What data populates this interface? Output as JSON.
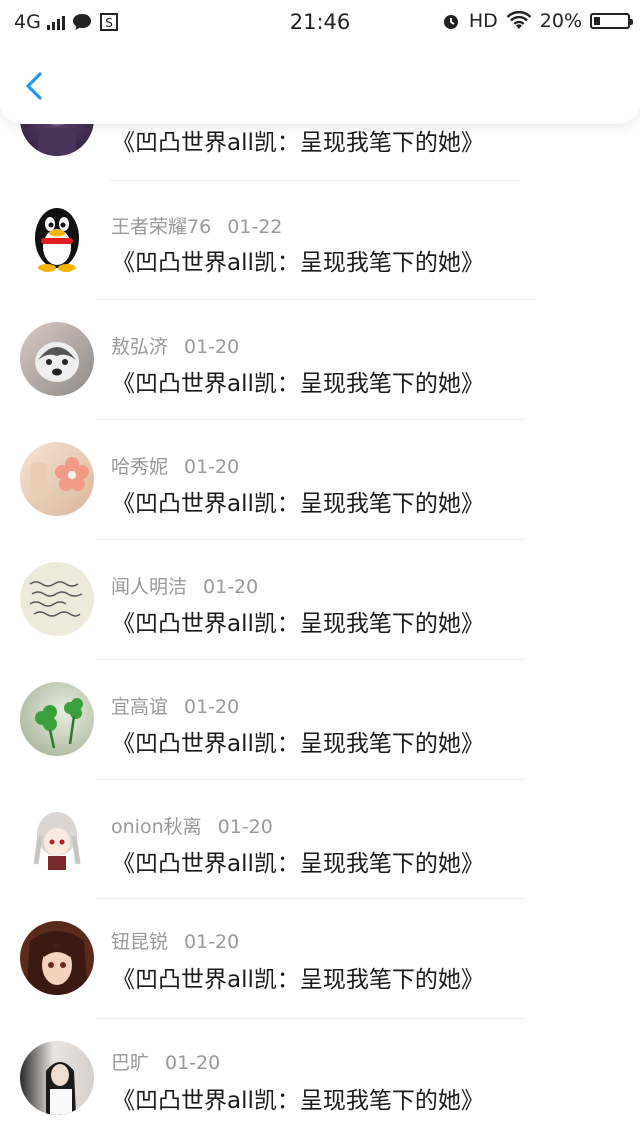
{
  "status_bar": {
    "network": "4G",
    "time": "21:46",
    "hd": "HD",
    "battery": "20%",
    "battery_level": 0.2
  },
  "header": {
    "back_icon": "chevron-left-icon",
    "accent_color": "#2196f3"
  },
  "items": [
    {
      "user": "",
      "date": "",
      "title": "《凹凸世界all凯：呈现我笔下的她》",
      "avatar": "dark-purple"
    },
    {
      "user": "王者荣耀76",
      "date": "01-22",
      "title": "《凹凸世界all凯：呈现我笔下的她》",
      "avatar": "penguin"
    },
    {
      "user": "敖弘济",
      "date": "01-20",
      "title": "《凹凸世界all凯：呈现我笔下的她》",
      "avatar": "husky"
    },
    {
      "user": "哈秀妮",
      "date": "01-20",
      "title": "《凹凸世界all凯：呈现我笔下的她》",
      "avatar": "flower"
    },
    {
      "user": "闻人明洁",
      "date": "01-20",
      "title": "《凹凸世界all凯：呈现我笔下的她》",
      "avatar": "handwriting"
    },
    {
      "user": "宜高谊",
      "date": "01-20",
      "title": "《凹凸世界all凯：呈现我笔下的她》",
      "avatar": "clover"
    },
    {
      "user": "onion秋离",
      "date": "01-20",
      "title": "《凹凸世界all凯：呈现我笔下的她》",
      "avatar": "anime-girl"
    },
    {
      "user": "钮昆锐",
      "date": "01-20",
      "title": "《凹凸世界all凯：呈现我笔下的她》",
      "avatar": "anime-dark"
    },
    {
      "user": "巴旷",
      "date": "01-20",
      "title": "《凹凸世界all凯：呈现我笔下的她》",
      "avatar": "photo-girl"
    }
  ]
}
